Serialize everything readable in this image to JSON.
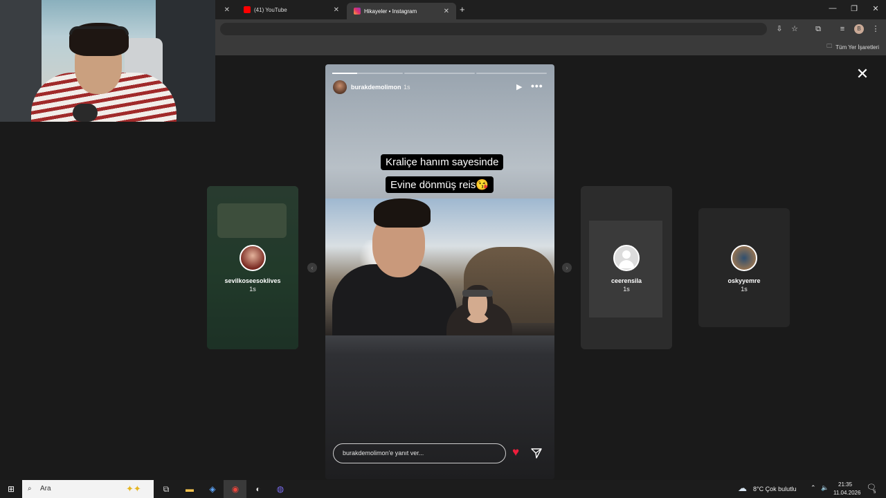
{
  "browser": {
    "tabs": [
      {
        "label": "",
        "active": false
      },
      {
        "label": "(41) YouTube",
        "active": false
      },
      {
        "label": "Hikayeler • Instagram",
        "active": true
      }
    ],
    "new_tab_glyph": "+",
    "bookmarks_folder": "Tüm Yer İşaretleri"
  },
  "story_viewer": {
    "author": "burakdemolimon",
    "time": "1s",
    "caption_line1": "Kraliçe hanım sayesinde",
    "caption_line2": "Evine dönmüş reis😘",
    "reply_placeholder": "burakdemolimon'e yanıt ver...",
    "progress": [
      0.35,
      0.0,
      0.0
    ],
    "icons": [
      "play-icon",
      "more-icon",
      "heart-icon",
      "send-icon",
      "close-icon"
    ]
  },
  "side_stories": [
    {
      "name": "sevilkoseesoklives",
      "time": "1s"
    },
    {
      "name": "ceerensila",
      "time": "1s"
    },
    {
      "name": "oskyyemre",
      "time": "1s"
    }
  ],
  "taskbar": {
    "search_placeholder": "Ara",
    "weather": "8°C  Çok bulutlu",
    "time": "21:35",
    "date": "11.04.2026",
    "notification_count": "5"
  },
  "colors": {
    "heart": "#ed1e3c",
    "instagram": "#e1306c",
    "youtube": "#ff0000"
  }
}
